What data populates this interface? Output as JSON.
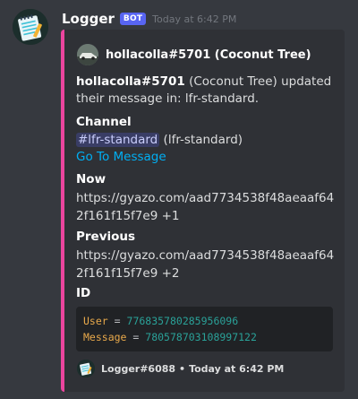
{
  "bot": {
    "name": "Logger",
    "tag": "BOT",
    "timestamp": "Today at 6:42 PM"
  },
  "embed": {
    "accent_color": "#eb459e",
    "author": "hollacolla#5701 (Coconut Tree)",
    "description_user": "hollacolla#5701",
    "description_rest": " (Coconut Tree) updated their message in: lfr-standard.",
    "fields": {
      "channel_name": "Channel",
      "channel_mention": "#lfr-standard",
      "channel_suffix": " (lfr-standard)",
      "channel_link": "Go To Message",
      "now_name": "Now",
      "now_value": "https://gyazo.com/aad7734538f48aeaaf642f161f15f7e9 +1",
      "previous_name": "Previous",
      "previous_value": "https://gyazo.com/aad7734538f48aeaaf642f161f15f7e9 +2",
      "id_name": "ID"
    },
    "code": {
      "user_key": "User",
      "user_value": "776835780285956096",
      "message_key": "Message",
      "message_value": "780578703108997122",
      "equals": "="
    },
    "footer": {
      "text": "Logger#6088",
      "separator": "•",
      "timestamp": "Today at 6:42 PM"
    }
  },
  "icons": {
    "avatar": "notepad-icon",
    "author": "car-photo-icon",
    "footer": "notepad-icon"
  }
}
